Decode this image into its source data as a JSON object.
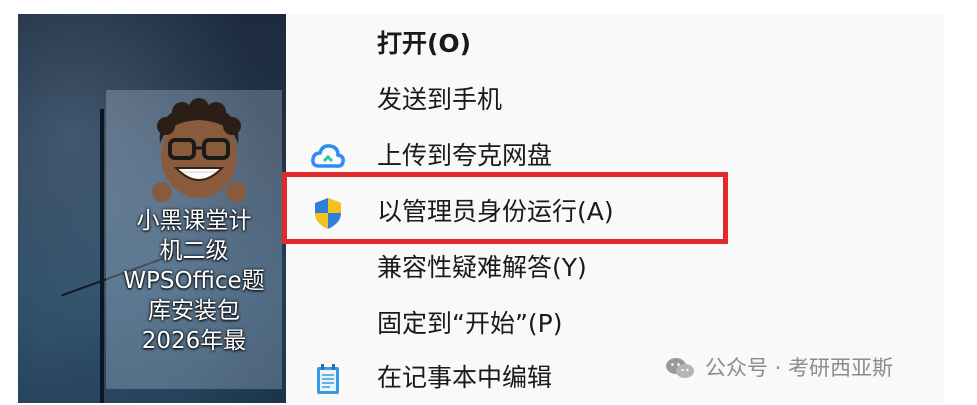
{
  "desktop": {
    "icon_label_lines": [
      "小黑课堂计",
      "机二级",
      "WPSOffice题",
      "库安装包",
      "2026年最"
    ]
  },
  "context_menu": {
    "items": [
      {
        "label": "打开(O)",
        "icon": "",
        "bold": true
      },
      {
        "label": "发送到手机",
        "icon": ""
      },
      {
        "label": "上传到夸克网盘",
        "icon": "quark-cloud-icon"
      },
      {
        "label": "以管理员身份运行(A)",
        "icon": "uac-shield-icon",
        "highlighted": true
      },
      {
        "label": "兼容性疑难解答(Y)",
        "icon": ""
      },
      {
        "label": "固定到“开始”(P)",
        "icon": ""
      },
      {
        "label": "在记事本中编辑",
        "icon": "notepad-icon"
      }
    ],
    "highlight_color": "#e1282b"
  },
  "watermark": {
    "text": "公众号 · 考研西亚斯"
  }
}
